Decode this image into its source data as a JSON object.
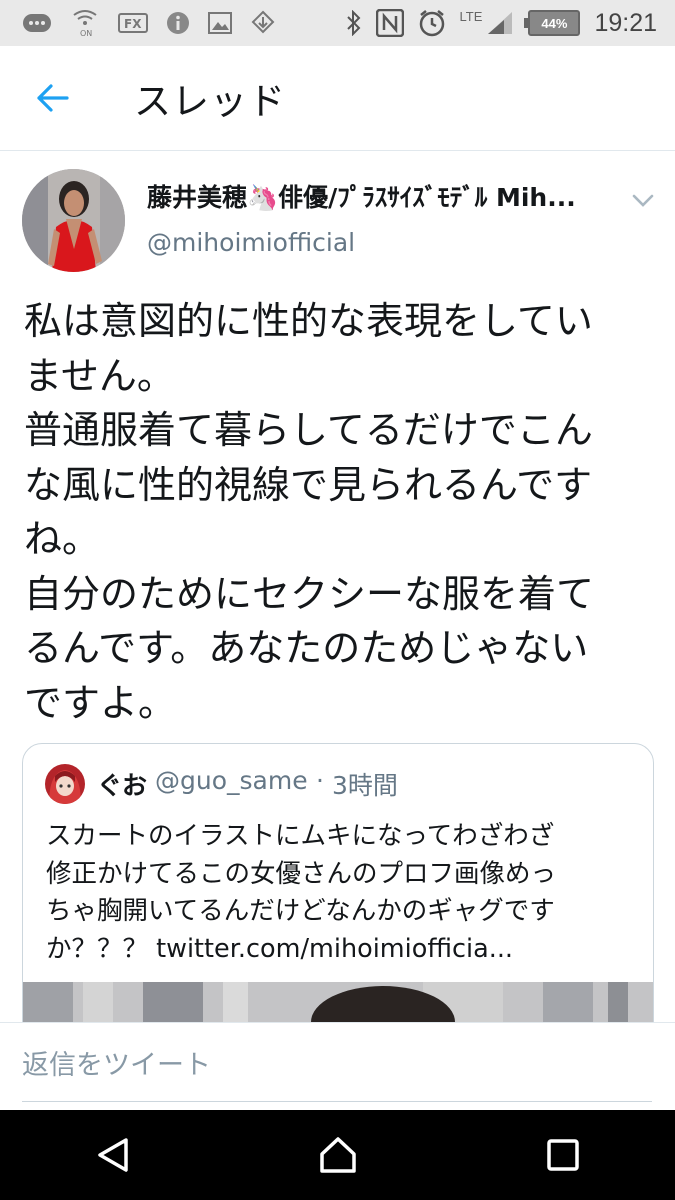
{
  "status_bar": {
    "time": "19:21",
    "battery": "44%",
    "network": "LTE",
    "icons": [
      "chat-icon",
      "wifi-calling-icon",
      "fx-icon",
      "info-icon",
      "image-icon",
      "download-icon",
      "bluetooth-icon",
      "nfc-icon",
      "alarm-icon",
      "signal-icon",
      "battery-icon"
    ]
  },
  "header": {
    "title": "スレッド",
    "back_icon": "back-arrow-icon"
  },
  "tweet": {
    "author_name": "藤井美穂🦄俳優/ﾌﾟﾗｽｻｲｽﾞﾓﾃﾞﾙ Mih...",
    "handle": "@mihoimiofficial",
    "text_lines": [
      "私は意図的に性的な表現をしてい",
      "ません。",
      "普通服着て暮らしてるだけでこん",
      "な風に性的視線で見られるんです",
      "ね。",
      "自分のためにセクシーな服を着て",
      "るんです。あなたのためじゃない",
      "ですよ。"
    ]
  },
  "quote": {
    "name": "ぐお",
    "handle": "@guo_same",
    "separator": "·",
    "time": "3時間",
    "text_lines": [
      "スカートのイラストにムキになってわざわざ",
      "修正かけてるこの女優さんのプロフ画像めっ",
      "ちゃ胸開いてるんだけどなんかのギャグです",
      "か？？？ twitter.com/mihoimiofficia..."
    ]
  },
  "reply": {
    "placeholder": "返信をツイート"
  },
  "colors": {
    "accent": "#1da1f2",
    "secondary_text": "#657786",
    "border": "#e1e8ed"
  }
}
